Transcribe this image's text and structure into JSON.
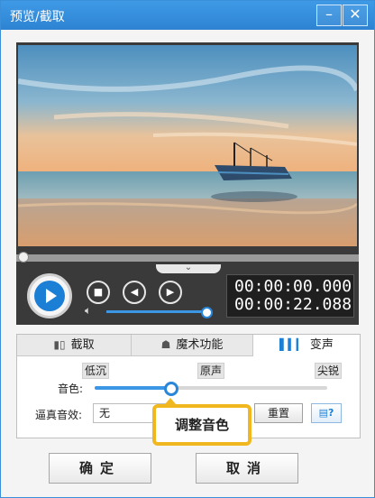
{
  "window": {
    "title": "预览/截取",
    "minimize_icon": "minimize-icon",
    "close_icon": "close-icon"
  },
  "preview": {
    "scene": "beach-sunset-boat-photo",
    "seek_progress": 0.0,
    "volume_level": 0.95,
    "time_current": "00:00:00.000",
    "time_total": "00:00:22.088",
    "buttons": {
      "play": "play-icon",
      "stop": "stop-icon",
      "prev_frame": "prev-frame-icon",
      "next_frame": "next-frame-icon",
      "volume": "speaker-icon",
      "collapse": "chevron-down-icon"
    }
  },
  "tabs": [
    {
      "label": "截取",
      "icon": "crop-icon",
      "active": false
    },
    {
      "label": "魔术功能",
      "icon": "magic-hat-icon",
      "active": false
    },
    {
      "label": "变声",
      "icon": "sound-wave-icon",
      "active": true
    }
  ],
  "voice": {
    "tick_low": "低沉",
    "tick_mid": "原声",
    "tick_high": "尖锐",
    "pitch_label": "音色:",
    "pitch_value": 0.33,
    "effect_label": "逼真音效:",
    "effect_value": "无",
    "reset_label": "重置",
    "help_icon": "help-icon"
  },
  "tooltip": "调整音色",
  "footer": {
    "ok_label": "确定",
    "cancel_label": "取消"
  },
  "colors": {
    "title_bar": "#2d83d2",
    "accent": "#1c7fd6",
    "tooltip_border": "#f0b71f"
  }
}
